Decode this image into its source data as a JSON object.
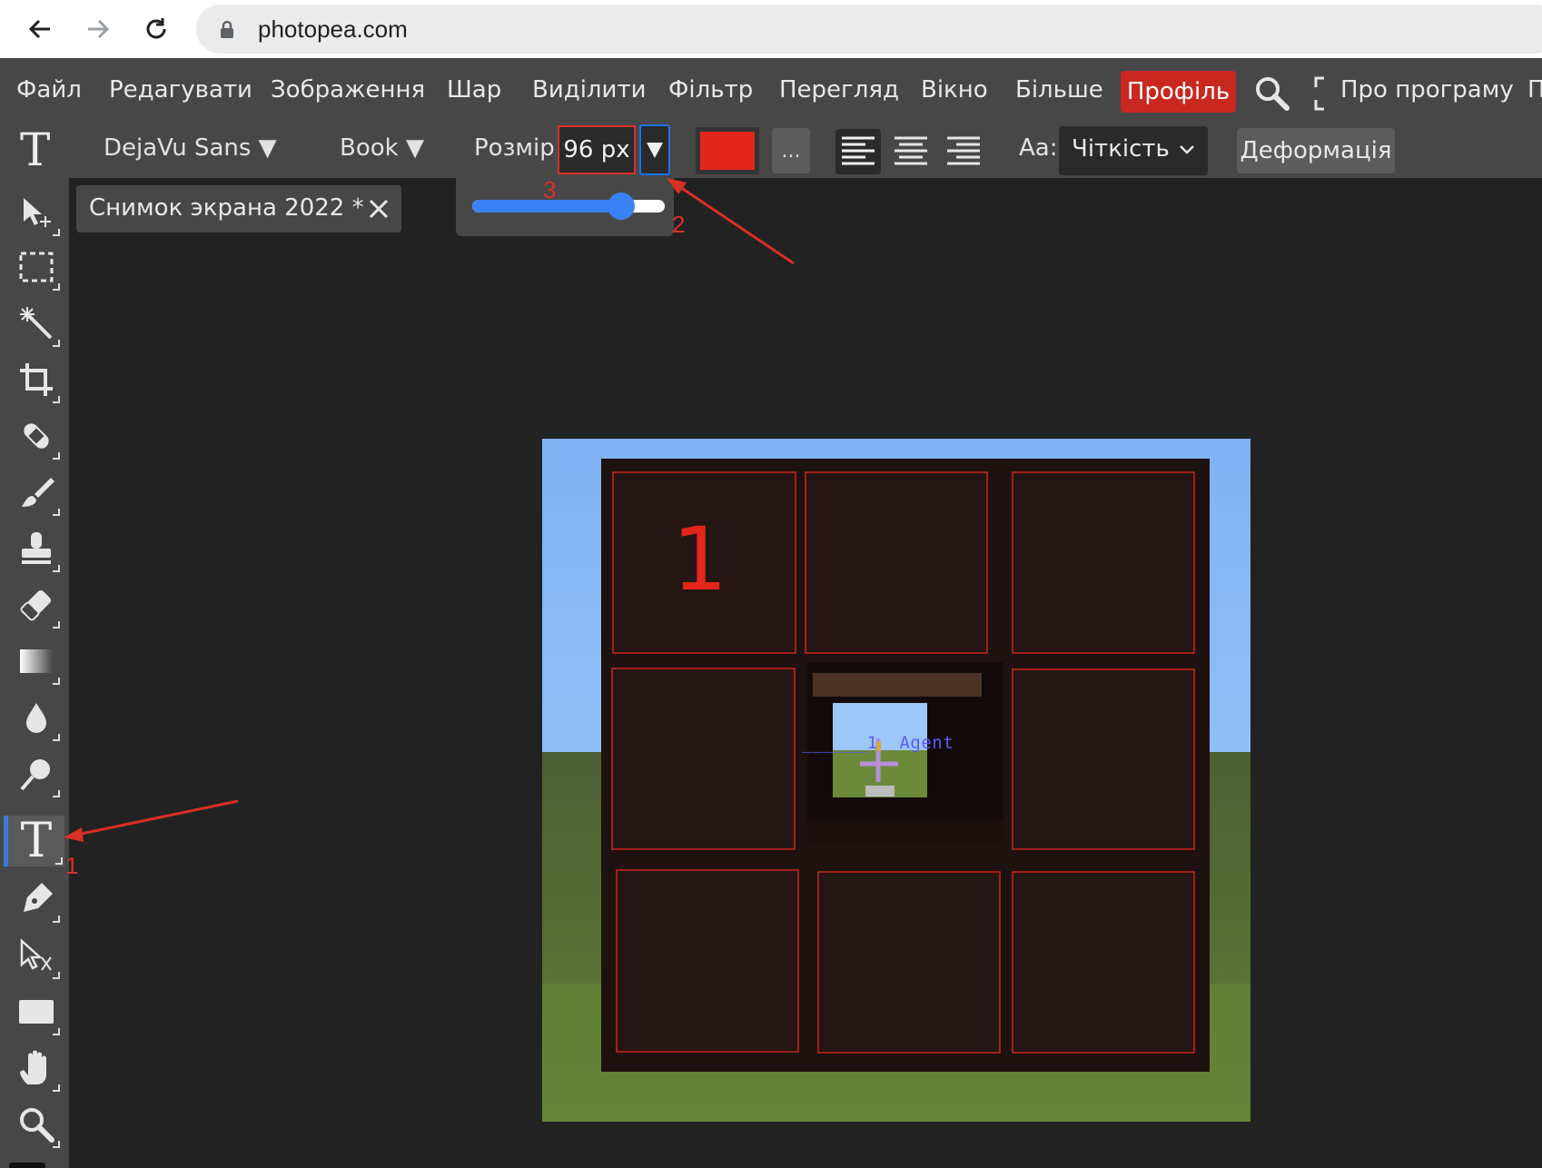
{
  "browser": {
    "url": "photopea.com"
  },
  "menu": {
    "items": [
      "Файл",
      "Редагувати",
      "Зображення",
      "Шар",
      "Виділити",
      "Фільтр",
      "Перегляд",
      "Вікно",
      "Більше"
    ],
    "profile": "Профіль",
    "about": "Про програму",
    "cut": "П"
  },
  "options": {
    "font": "DejaVu Sans",
    "style": "Book",
    "size_label": "Розмір",
    "size_value": "96 px",
    "text_color": "#e3261b",
    "more": "...",
    "aa_label": "Aa:",
    "aa_value": "Чіткість",
    "warp": "Деформація",
    "size_slider_level": 0.82
  },
  "document": {
    "tab_title": "Снимок экрана 2022 *"
  },
  "canvas_text": {
    "number": "1",
    "agent": "______1  Agent"
  },
  "annotations": {
    "one": "1",
    "two": "2",
    "three": "3"
  },
  "tools": [
    "move-tool",
    "marquee-tool",
    "magic-wand-tool",
    "crop-tool",
    "healing-tool",
    "brush-tool",
    "stamp-tool",
    "eraser-tool",
    "gradient-tool",
    "blur-tool",
    "dodge-tool",
    "text-tool",
    "pen-tool",
    "path-select-tool",
    "shape-tool",
    "hand-tool",
    "zoom-tool"
  ],
  "active_tool": "text-tool"
}
